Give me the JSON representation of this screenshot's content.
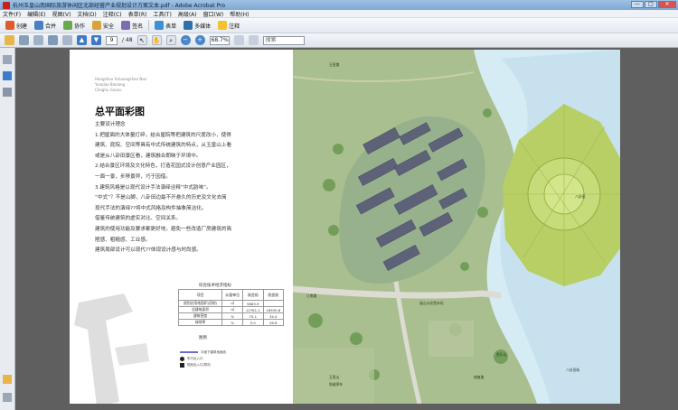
{
  "window": {
    "title": "杭州玉皇山南国际旅游休闲区北部经营产业规划设计方案文本.pdf - Adobe Acrobat Pro",
    "controls": [
      "—",
      "□",
      "✕"
    ]
  },
  "menu": [
    "文件(F)",
    "编辑(E)",
    "视图(V)",
    "文档(D)",
    "注释(C)",
    "表单(R)",
    "工具(T)",
    "高级(A)",
    "窗口(W)",
    "帮助(H)"
  ],
  "toolbar": {
    "create": "创建",
    "combine": "合并",
    "collaborate": "协作",
    "secure": "安全",
    "sign": "签名",
    "forms": "表单",
    "multimedia": "多媒体",
    "comment": "注释"
  },
  "nav": {
    "page_current": "9",
    "page_total": "/ 48",
    "zoom": "68.7%",
    "search_placeholder": "搜索"
  },
  "doc": {
    "en_lines": [
      "Hangzhou Yuhuangshan Nan",
      "Yunqiao Baxiang",
      "Chaghu Guoxu"
    ],
    "section_title": "总平面彩图",
    "paragraphs": [
      "主要设计理念",
      "1.把屋面的大体量打碎，结合屋院等把建筑的尺度改小，使得",
      "建筑、庭院、空间等具有中式传统建筑的特点，从玉皇山上看",
      "或是从八卦田景区看，建筑融合朗映于环境中。",
      "2.结合景区环境及文化特色，打造花园式设计创意产业园区，",
      "一面一景，步移景异，巧于因借。",
      "3.建筑风格是以现代设计手法演绎诠释“中式韵味”。",
      "  “中式”？不是山脚，八卦田边最不开悬久的历史及文化去简",
      "现代手法的演绎??将中式风格及构件抽象简洁化。",
      "借鉴传统建筑的虚实对比、空间关系。",
      "建筑的使用功能及要求都更好地，避免一些改造厂房建筑的简",
      "陋感、粗糙感、工业感。",
      "建筑局部设计可以现代??体现设计感与时尚感。"
    ],
    "table_title": "综合技术经济指标",
    "table_headers": [
      "项目",
      "计量单位",
      "改造前",
      "改造前"
    ],
    "table_rows": [
      [
        "规划总用地面积(用地)",
        "㎡",
        "5683.9",
        ""
      ],
      [
        "总建筑面积",
        "㎡",
        "12761.1",
        "16930.8"
      ],
      [
        "建筑密度",
        "%",
        "75.1",
        "34.4"
      ],
      [
        "绿地率",
        "%",
        "5.0",
        "26.8"
      ]
    ],
    "legend_title": "图例",
    "legend_items": [
      "平面下建筑地面线",
      "车行出入口",
      "规划出入口/导向"
    ],
    "map_labels": {
      "road_top": "玉皇路",
      "bagua": "八卦田",
      "parking": "溪山公交首末站",
      "yuheng": "玉皇山",
      "coordination": "和谐停车",
      "jiangnan": "江南路",
      "ridge": "鱼乐山",
      "south_road": "南复路",
      "right_bottom": "八卦田街"
    }
  },
  "colors": {
    "accent": "#c8201e",
    "toolbar": "#e4e9f0",
    "water": "#c9e2ef",
    "field": "#b9d36b"
  }
}
